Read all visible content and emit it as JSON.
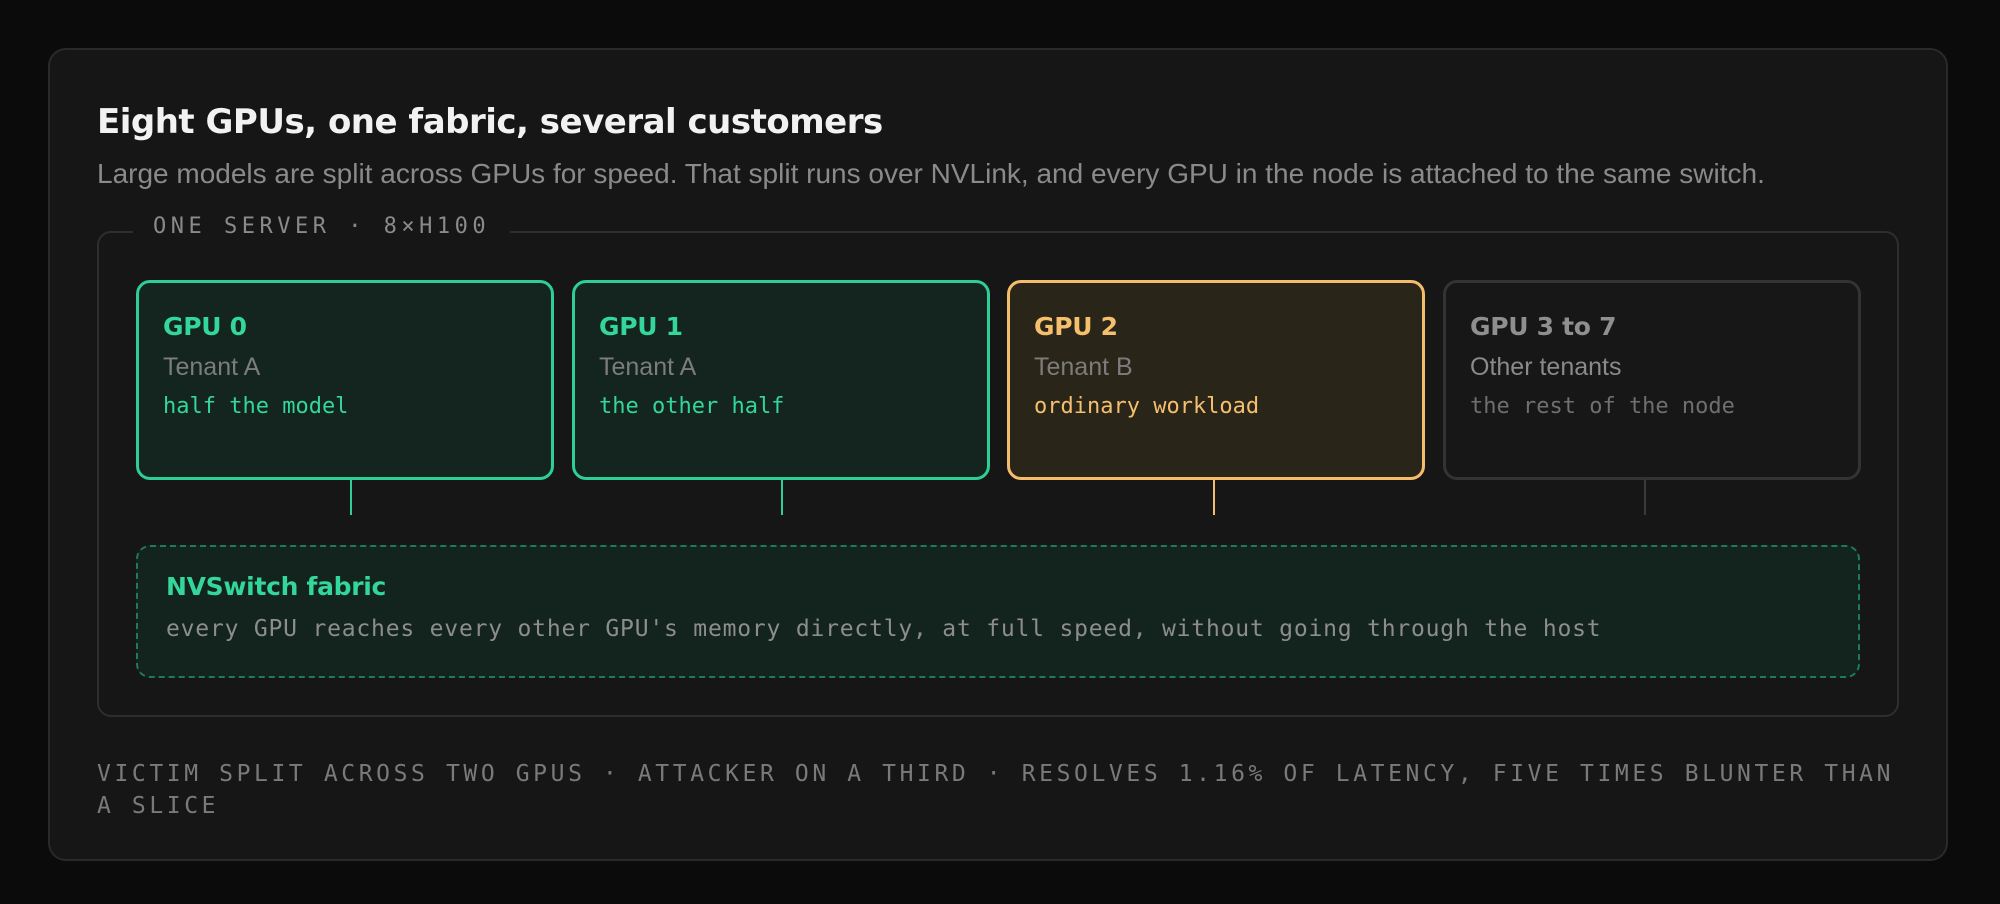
{
  "title": "Eight GPUs, one fabric, several customers",
  "subtitle": "Large models are split across GPUs for speed. That split runs over NVLink, and every GPU in the node is attached to the same switch.",
  "server_label": "ONE SERVER · 8×H100",
  "gpus": [
    {
      "name": "GPU 0",
      "tenant": "Tenant A",
      "role": "half the model",
      "color": "#33d69b"
    },
    {
      "name": "GPU 1",
      "tenant": "Tenant A",
      "role": "the other half",
      "color": "#33d69b"
    },
    {
      "name": "GPU 2",
      "tenant": "Tenant B",
      "role": "ordinary workload",
      "color": "#f6bf6e"
    },
    {
      "name": "GPU 3 to 7",
      "tenant": "Other tenants",
      "role": "the rest of the node",
      "color": "#8f8f8f"
    }
  ],
  "fabric": {
    "title": "NVSwitch fabric",
    "description": "every GPU reaches every other GPU's memory directly, at full speed, without going through the host"
  },
  "footer": "VICTIM SPLIT ACROSS TWO GPUS · ATTACKER ON A THIRD · RESOLVES 1.16% OF LATENCY, FIVE TIMES BLUNTER THAN A SLICE"
}
